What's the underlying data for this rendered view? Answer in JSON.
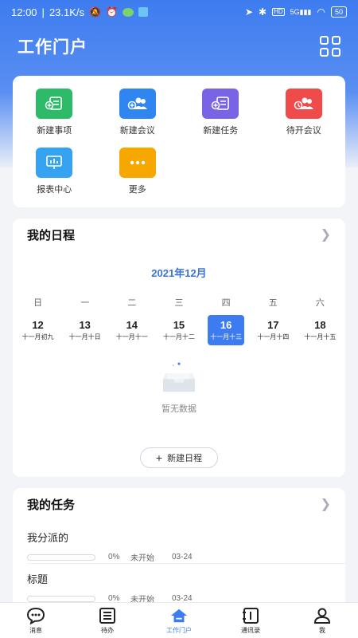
{
  "status_bar": {
    "time": "12:00",
    "speed": "23.1K/s",
    "network": "5G",
    "hd": "HD",
    "battery": "50"
  },
  "header": {
    "title": "工作门户"
  },
  "quick_actions": [
    {
      "label": "新建事项",
      "icon": "new-item-icon",
      "color": "#2dbb6a"
    },
    {
      "label": "新建会议",
      "icon": "new-meeting-icon",
      "color": "#2f86f0"
    },
    {
      "label": "新建任务",
      "icon": "new-task-icon",
      "color": "#7a64e6"
    },
    {
      "label": "待开会议",
      "icon": "pending-meeting-icon",
      "color": "#ef4b4b"
    },
    {
      "label": "报表中心",
      "icon": "report-icon",
      "color": "#35a3f2"
    },
    {
      "label": "更多",
      "icon": "more-icon",
      "color": "#f7a800"
    }
  ],
  "schedule": {
    "title": "我的日程",
    "month": "2021年12月",
    "weekdays": [
      "日",
      "一",
      "二",
      "三",
      "四",
      "五",
      "六"
    ],
    "days": [
      {
        "num": "12",
        "lunar": "十一月初九"
      },
      {
        "num": "13",
        "lunar": "十一月十日"
      },
      {
        "num": "14",
        "lunar": "十一月十一"
      },
      {
        "num": "15",
        "lunar": "十一月十二"
      },
      {
        "num": "16",
        "lunar": "十一月十三"
      },
      {
        "num": "17",
        "lunar": "十一月十四"
      },
      {
        "num": "18",
        "lunar": "十一月十五"
      }
    ],
    "selected_day": "16",
    "empty_text": "暂无数据",
    "new_button": "新建日程",
    "plus": "+"
  },
  "tasks": {
    "title": "我的任务",
    "items": [
      {
        "name": "我分派的",
        "progress": "0%",
        "status": "未开始",
        "date": "03-24"
      },
      {
        "name": "标题",
        "progress": "0%",
        "status": "未开始",
        "date": "03-24"
      }
    ]
  },
  "bottom_nav": [
    {
      "label": "消息",
      "icon": "message-icon"
    },
    {
      "label": "待办",
      "icon": "todo-icon"
    },
    {
      "label": "工作门户",
      "icon": "portal-icon"
    },
    {
      "label": "通讯录",
      "icon": "contacts-icon"
    },
    {
      "label": "我",
      "icon": "profile-icon"
    }
  ],
  "colors": {
    "accent": "#3d7cf0"
  }
}
